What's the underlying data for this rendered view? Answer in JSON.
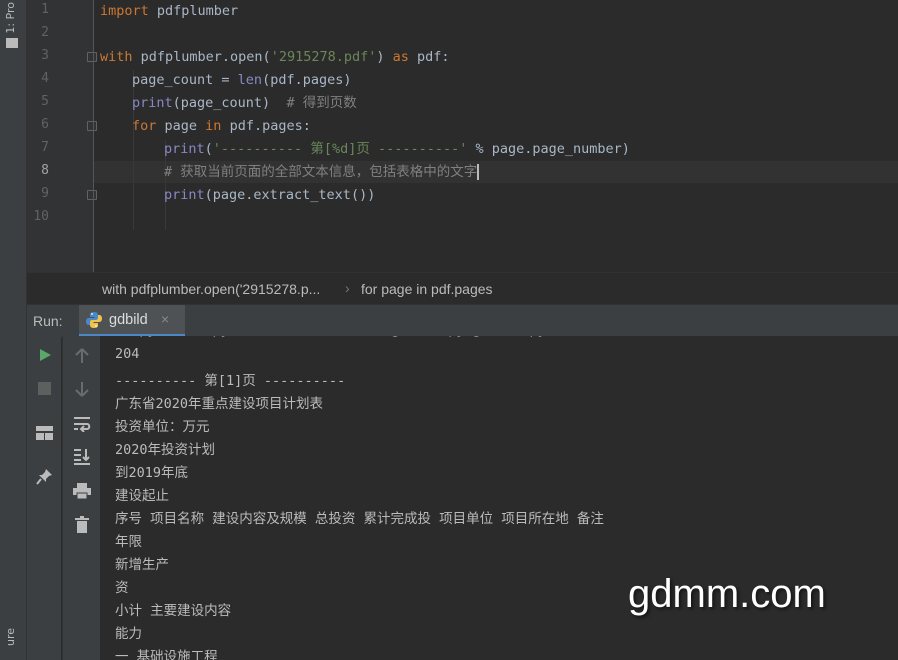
{
  "side_panel": {
    "project_tab": "1: Pro",
    "bottom_tab": "ure"
  },
  "editor": {
    "line_numbers": [
      "1",
      "2",
      "3",
      "4",
      "5",
      "6",
      "7",
      "8",
      "9",
      "10"
    ],
    "lines": {
      "l1": {
        "kw": "import",
        "rest": " pdfplumber"
      },
      "l3": {
        "kw1": "with",
        "mid": " pdfplumber.open(",
        "str": "'2915278.pdf'",
        "mid2": ") ",
        "kw2": "as",
        "end": " pdf:"
      },
      "l4": {
        "pre": "page_count = ",
        "bi": "len",
        "rest": "(pdf.pages)"
      },
      "l5": {
        "bi": "print",
        "rest": "(page_count)  ",
        "cm": "# 得到页数"
      },
      "l6": {
        "kw1": "for",
        "mid": " page ",
        "kw2": "in",
        "rest": " pdf.pages:"
      },
      "l7": {
        "bi": "print",
        "p1": "(",
        "str": "'---------- 第[%d]页 ----------'",
        "rest": " % page.page_number)"
      },
      "l8": {
        "cm": "# 获取当前页面的全部文本信息，包括表格中的文字"
      },
      "l9": {
        "bi": "print",
        "rest": "(page.extract_text())"
      }
    }
  },
  "breadcrumb": {
    "item1": "with pdfplumber.open('2915278.p...",
    "item2": "for page in pdf.pages"
  },
  "run_panel": {
    "label": "Run:",
    "tab_name": "gdbild",
    "close_glyph": "×"
  },
  "console": {
    "lines": [
      "204",
      "---------- 第[1]页 ----------",
      "广东省2020年重点建设项目计划表",
      "投资单位：万元",
      "2020年投资计划",
      "到2019年底",
      "建设起止",
      "序号 项目名称 建设内容及规模 总投资 累计完成投 项目单位 项目所在地 备注",
      "年限",
      "新增生产",
      "资",
      "小计 主要建设内容",
      "能力",
      "一 基础设施工程"
    ]
  },
  "toolbar_icons": [
    "run-icon",
    "stop-icon",
    "layout-icon",
    "pin-icon",
    "up-arrow-icon",
    "down-arrow-icon",
    "soft-wrap-icon",
    "scroll-to-end-icon",
    "print-icon",
    "trash-icon"
  ],
  "watermark": "gdmm.com"
}
